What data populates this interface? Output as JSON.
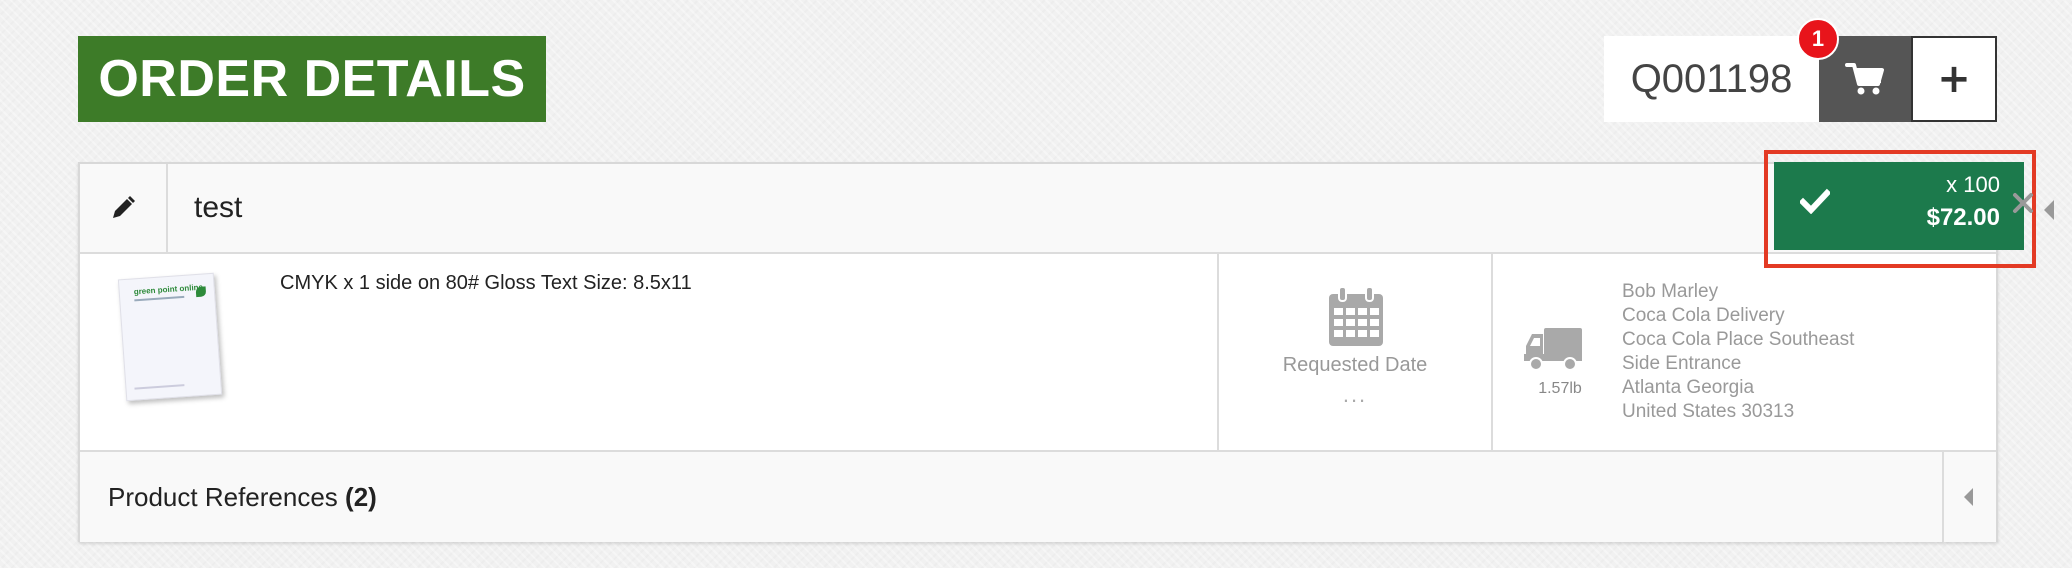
{
  "header": {
    "title": "ORDER DETAILS",
    "quote_number": "Q001198",
    "cart_count": "1",
    "add_label": "+"
  },
  "item": {
    "name": "test",
    "quantity": "x 100",
    "price": "$72.00",
    "description": "CMYK x 1 side on 80# Gloss Text Size: 8.5x11",
    "thumbnail_text": "green point online",
    "requested_date_label": "Requested Date",
    "requested_date_value": "...",
    "weight": "1.57lb",
    "shipping_address": [
      "Bob Marley",
      "Coca Cola Delivery",
      "Coca Cola Place Southeast",
      "Side Entrance",
      "Atlanta Georgia",
      "United States 30313"
    ]
  },
  "references": {
    "label": "Product References",
    "count": "(2)"
  },
  "colors": {
    "title_green": "#3d7b28",
    "price_green": "#1c7a4c",
    "badge_red": "#e8141b",
    "highlight_red": "#e33a24"
  },
  "icons": [
    "pencil-icon",
    "check-icon",
    "cart-icon",
    "calendar-icon",
    "truck-icon",
    "close-icon",
    "caret-left-icon"
  ]
}
